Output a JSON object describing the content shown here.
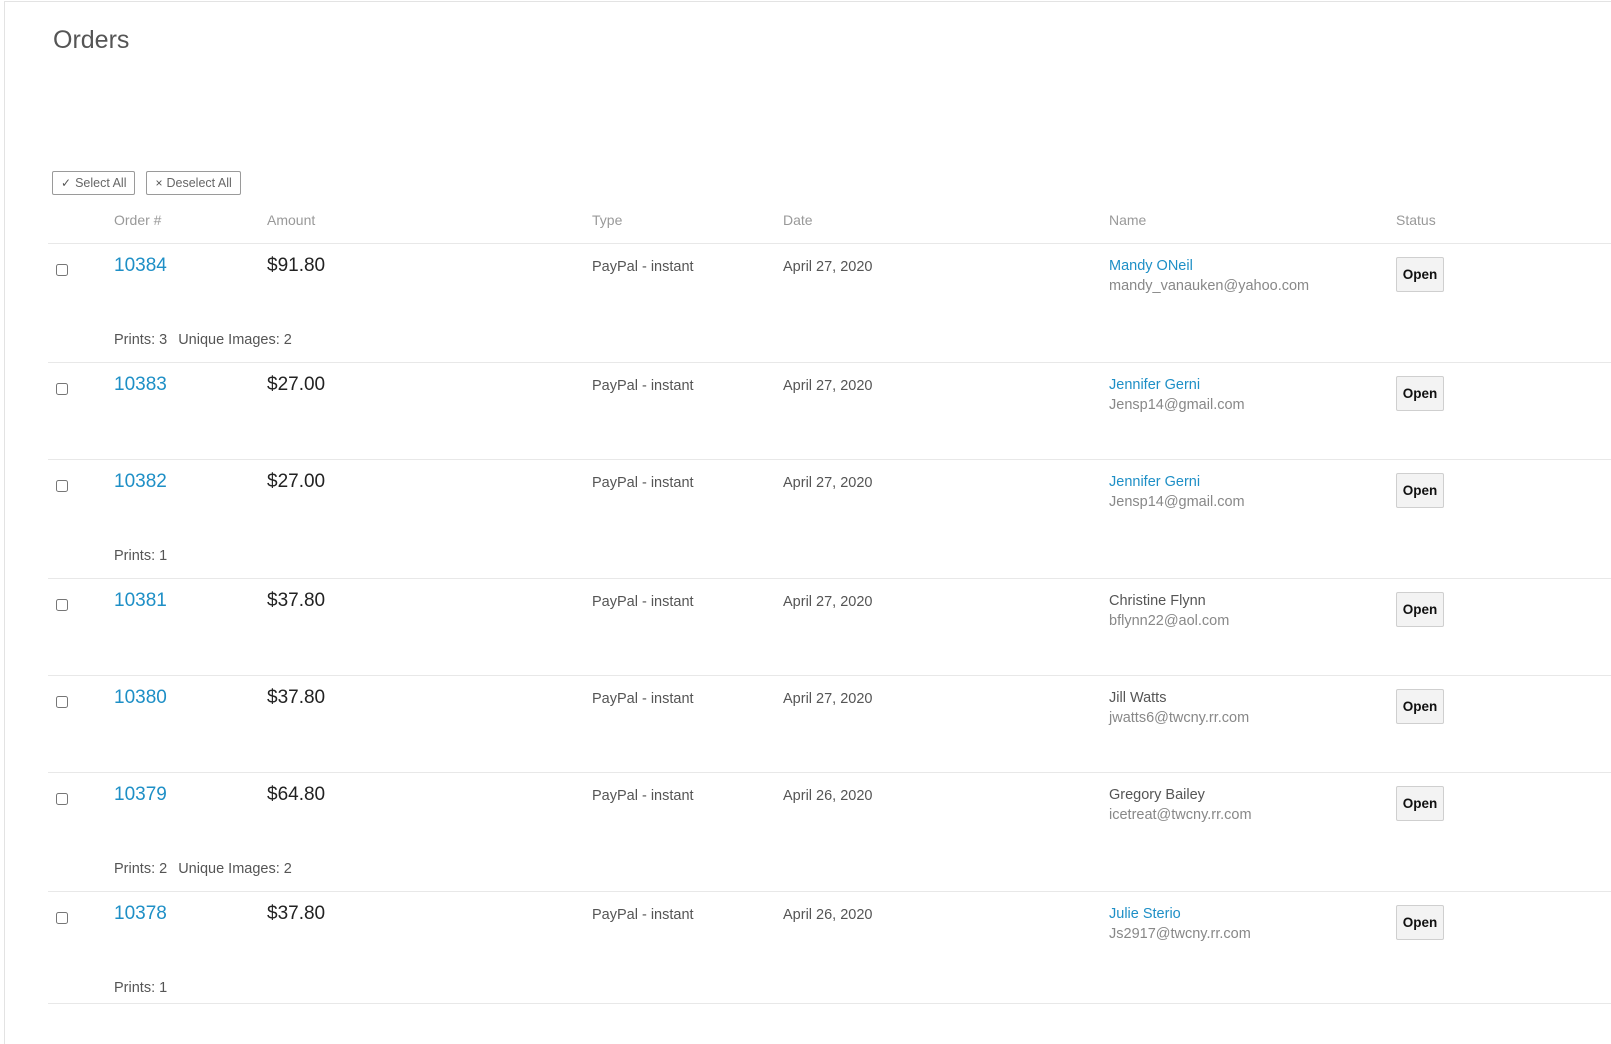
{
  "page": {
    "title": "Orders"
  },
  "toolbar": {
    "select_all": {
      "icon": "check-icon",
      "glyph": "✓",
      "label": "Select All"
    },
    "deselect_all": {
      "icon": "x-icon",
      "glyph": "×",
      "label": "Deselect All"
    }
  },
  "columns": {
    "order": "Order #",
    "amount": "Amount",
    "type": "Type",
    "date": "Date",
    "name": "Name",
    "status": "Status"
  },
  "orders": [
    {
      "number": "10384",
      "amount": "$91.80",
      "type": "PayPal - instant",
      "date": "April 27, 2020",
      "name": "Mandy ONeil",
      "name_linked": true,
      "email": "mandy_vanauken@yahoo.com",
      "status": "Open",
      "prints": "Prints: 3",
      "unique_images": "Unique Images: 2"
    },
    {
      "number": "10383",
      "amount": "$27.00",
      "type": "PayPal - instant",
      "date": "April 27, 2020",
      "name": "Jennifer Gerni",
      "name_linked": true,
      "email": "Jensp14@gmail.com",
      "status": "Open",
      "prints": "",
      "unique_images": ""
    },
    {
      "number": "10382",
      "amount": "$27.00",
      "type": "PayPal - instant",
      "date": "April 27, 2020",
      "name": "Jennifer Gerni",
      "name_linked": true,
      "email": "Jensp14@gmail.com",
      "status": "Open",
      "prints": "Prints: 1",
      "unique_images": ""
    },
    {
      "number": "10381",
      "amount": "$37.80",
      "type": "PayPal - instant",
      "date": "April 27, 2020",
      "name": "Christine Flynn",
      "name_linked": false,
      "email": "bflynn22@aol.com",
      "status": "Open",
      "prints": "",
      "unique_images": ""
    },
    {
      "number": "10380",
      "amount": "$37.80",
      "type": "PayPal - instant",
      "date": "April 27, 2020",
      "name": "Jill Watts",
      "name_linked": false,
      "email": "jwatts6@twcny.rr.com",
      "status": "Open",
      "prints": "",
      "unique_images": ""
    },
    {
      "number": "10379",
      "amount": "$64.80",
      "type": "PayPal - instant",
      "date": "April 26, 2020",
      "name": "Gregory Bailey",
      "name_linked": false,
      "email": "icetreat@twcny.rr.com",
      "status": "Open",
      "prints": "Prints: 2",
      "unique_images": "Unique Images: 2"
    },
    {
      "number": "10378",
      "amount": "$37.80",
      "type": "PayPal - instant",
      "date": "April 26, 2020",
      "name": "Julie Sterio",
      "name_linked": true,
      "email": "Js2917@twcny.rr.com",
      "status": "Open",
      "prints": "Prints: 1",
      "unique_images": ""
    }
  ]
}
